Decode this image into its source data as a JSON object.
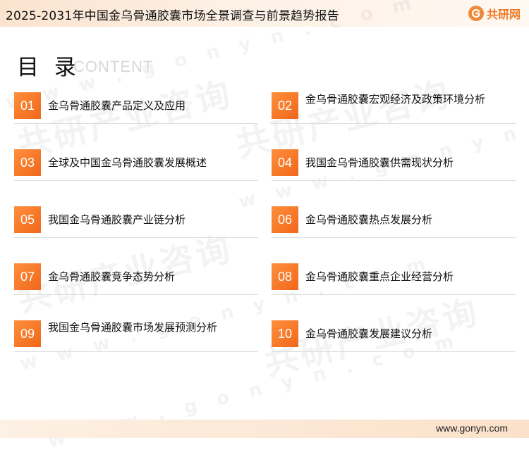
{
  "header": {
    "title": "2025-2031年中国金乌骨通胶囊市场全景调查与前景趋势报告",
    "logo_text": "共研网",
    "logo_icon": "gonyn-logo-icon"
  },
  "heading": {
    "title": "目 录",
    "subtitle": "CONTENT"
  },
  "watermark": {
    "text": "共研产业咨询",
    "url": "w w w . g o n y n . c o m"
  },
  "colors": {
    "accent": "#f0671b",
    "accent_light": "#ff8f3c",
    "banner": "#fbe3cf"
  },
  "toc": [
    {
      "num": "01",
      "label": "金乌骨通胶囊产品定义及应用"
    },
    {
      "num": "02",
      "label": "金乌骨通胶囊宏观经济及政策环境分析"
    },
    {
      "num": "03",
      "label": "全球及中国金乌骨通胶囊发展概述"
    },
    {
      "num": "04",
      "label": "我国金乌骨通胶囊供需现状分析"
    },
    {
      "num": "05",
      "label": "我国金乌骨通胶囊产业链分析"
    },
    {
      "num": "06",
      "label": "金乌骨通胶囊热点发展分析"
    },
    {
      "num": "07",
      "label": "金乌骨通胶囊竞争态势分析"
    },
    {
      "num": "08",
      "label": "金乌骨通胶囊重点企业经营分析"
    },
    {
      "num": "09",
      "label": "我国金乌骨通胶囊市场发展预测分析"
    },
    {
      "num": "10",
      "label": "金乌骨通胶囊发展建议分析"
    }
  ],
  "footer": {
    "url": "www.gonyn.com"
  }
}
